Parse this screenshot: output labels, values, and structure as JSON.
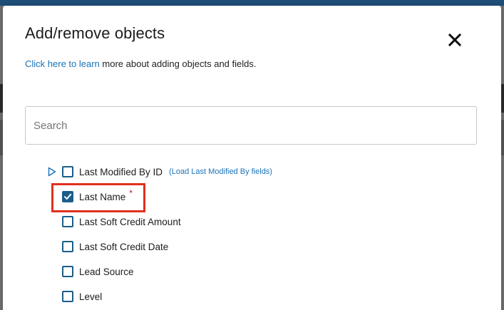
{
  "dialog": {
    "title": "Add/remove objects",
    "help_link": "Click here to learn",
    "help_text": " more about adding objects and fields."
  },
  "search": {
    "placeholder": "Search",
    "value": ""
  },
  "fields": [
    {
      "label": "Last Modified By ID",
      "checked": false,
      "expandable": true,
      "link": "(Load Last Modified By fields)"
    },
    {
      "label": "Last Name",
      "checked": true,
      "required": true
    },
    {
      "label": "Last Soft Credit Amount",
      "checked": false
    },
    {
      "label": "Last Soft Credit Date",
      "checked": false
    },
    {
      "label": "Lead Source",
      "checked": false
    },
    {
      "label": "Level",
      "checked": false
    }
  ],
  "required_marker": "*",
  "colors": {
    "accent": "#1b5e8a",
    "link": "#1a73b8",
    "highlight": "#e0301e",
    "required": "#c0152f"
  },
  "icons": {
    "close": "close-icon",
    "expand": "triangle-right-icon",
    "check": "checkmark-icon"
  }
}
